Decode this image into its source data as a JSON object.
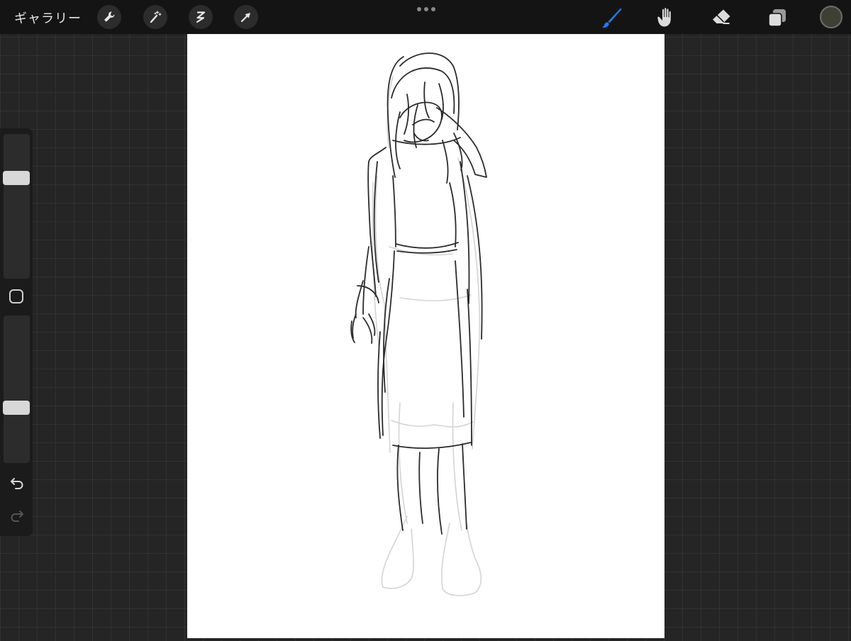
{
  "toolbar": {
    "gallery_label": "ギャラリー",
    "left_tools": [
      "wrench-icon",
      "magic-wand-icon",
      "selection-icon",
      "transform-arrow-icon"
    ],
    "more_menu_icon": "more-dots-icon",
    "right_tools": [
      "brush-icon",
      "smudge-icon",
      "eraser-icon",
      "layers-icon"
    ],
    "active_tool": "brush",
    "accent_color": "#1e7cf2",
    "current_color": "#3f3f34"
  },
  "sidebar": {
    "brush_size_level": 0.28,
    "opacity_level": 0.64,
    "modify_icon": "square-modify-icon",
    "undo_icon": "undo-arrow-icon",
    "redo_icon": "redo-arrow-icon",
    "redo_enabled": false
  },
  "canvas": {
    "background": "#ffffff",
    "content": "pencil-sketch-figure"
  }
}
